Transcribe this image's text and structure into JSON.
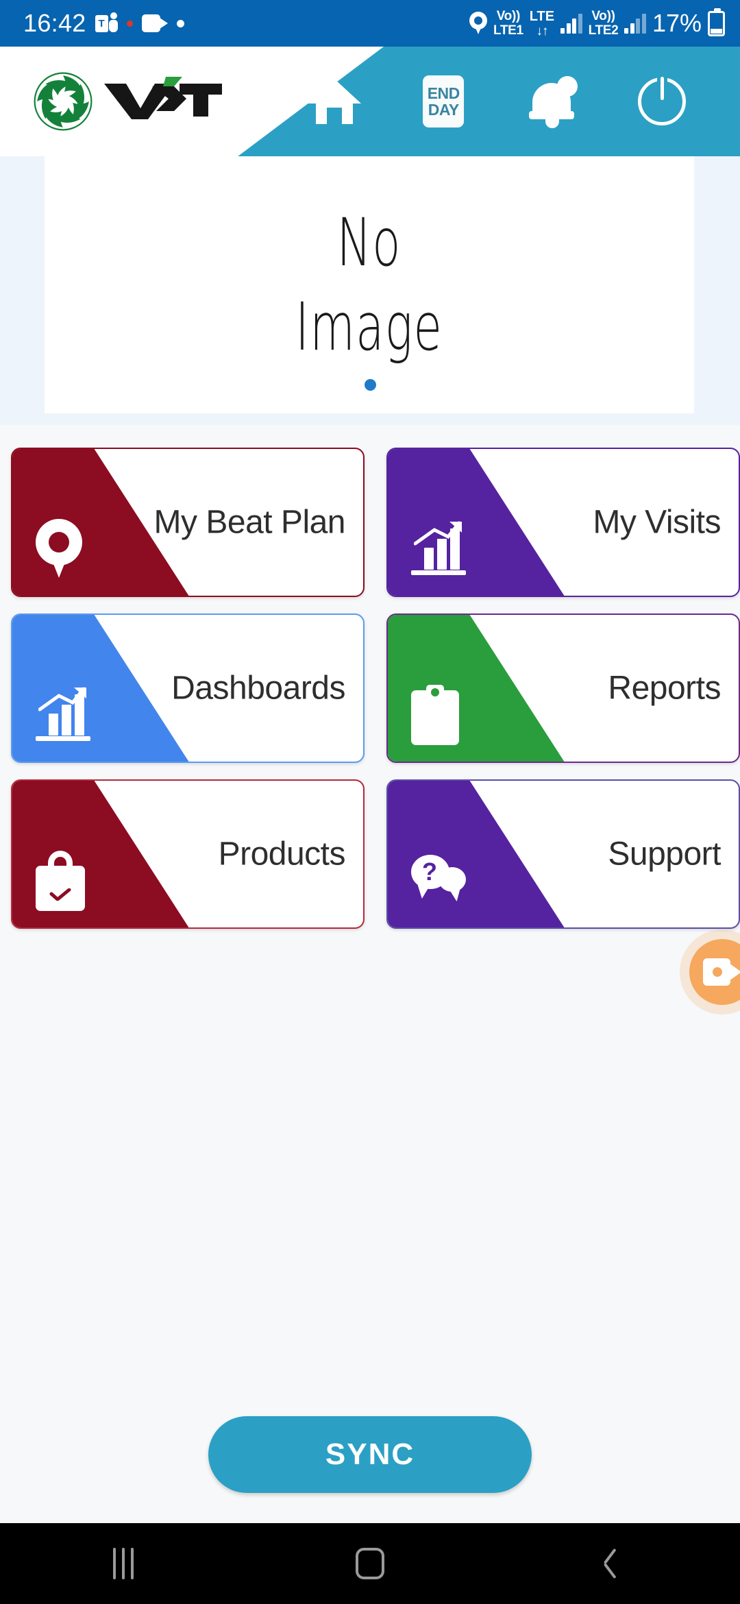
{
  "status_bar": {
    "time": "16:42",
    "teams_icon": "teams-icon",
    "recording_dot": "red-dot",
    "camera_icon": "video-camera-icon",
    "white_dot": "white-dot",
    "location_icon": "location-pin-icon",
    "sim1_volte_l1": "Vo))",
    "sim1_volte_l2": "LTE1",
    "lte_l1": "LTE",
    "lte_l2": "↓↑",
    "sim2_volte_l1": "Vo))",
    "sim2_volte_l2": "LTE2",
    "battery_percent": "17%",
    "battery_icon": "battery-icon",
    "background_color": "#0764b0"
  },
  "header": {
    "logo_text": "VST",
    "logo_mark": "vst-swirl-logo",
    "background_color": "#2ba0c4",
    "actions": [
      {
        "name": "home",
        "icon": "home-icon",
        "label": ""
      },
      {
        "name": "end-day",
        "icon": "end-day-icon",
        "line1": "END",
        "line2": "DAY"
      },
      {
        "name": "notifications",
        "icon": "bell-icon",
        "label": ""
      },
      {
        "name": "power",
        "icon": "power-icon",
        "label": ""
      }
    ]
  },
  "carousel": {
    "placeholder_line1": "No",
    "placeholder_line2": "Image",
    "dots": 1,
    "active_dot": 0,
    "dot_color": "#1f7ac7"
  },
  "tiles": [
    {
      "label": "My Beat Plan",
      "color": "#8c0c22",
      "icon": "location-pin-icon",
      "border": "#8c0c22"
    },
    {
      "label": "My Visits",
      "color": "#5522a0",
      "icon": "bar-chart-up-icon",
      "border": "#5522a0"
    },
    {
      "label": "Dashboards",
      "color": "#4285ec",
      "icon": "bar-chart-up-icon",
      "border": "#5b9bf0"
    },
    {
      "label": "Reports",
      "color": "#2a9d3c",
      "icon": "clipboard-icon",
      "border": "#6b2a8c"
    },
    {
      "label": "Products",
      "color": "#8c0c22",
      "icon": "shopping-bag-check-icon",
      "border": "#b32a3d"
    },
    {
      "label": "Support",
      "color": "#5522a0",
      "icon": "help-chat-icon",
      "border": "#5b4ea8"
    }
  ],
  "floating_button": {
    "name": "screen-record-button",
    "icon": "video-camera-icon",
    "color": "#f5a85e"
  },
  "sync": {
    "label": "SYNC",
    "color": "#2ba0c4"
  },
  "navigation_bar": {
    "recents": "recents-icon",
    "home": "home-square-icon",
    "back": "back-chevron-icon"
  }
}
